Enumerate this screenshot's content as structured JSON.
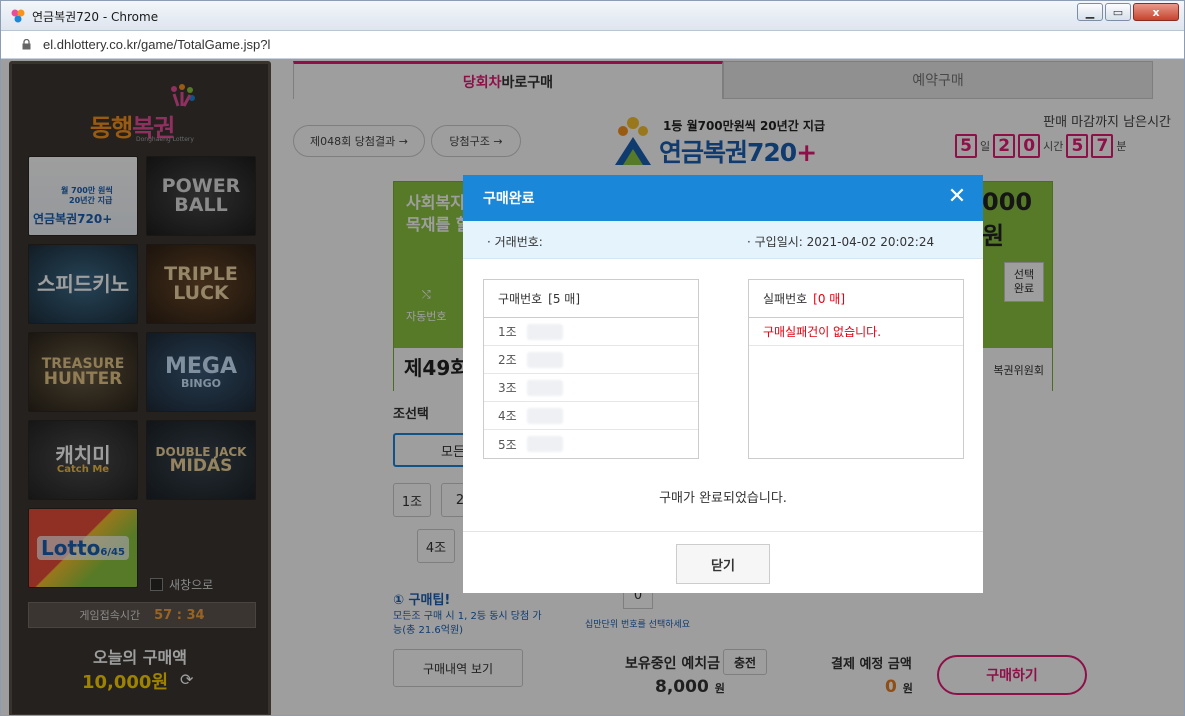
{
  "browser": {
    "title": "연금복권720 - Chrome",
    "url": "el.dhlottery.co.kr/game/TotalGame.jsp?l",
    "icons": {
      "app": "chrome-icon",
      "lock": "lock-icon",
      "minimize": "minimize-icon",
      "maximize": "maximize-icon",
      "close": "close-icon"
    },
    "close_glyph": "x"
  },
  "sidebar": {
    "logo": {
      "text_a": "동행",
      "text_b": "복권",
      "sub": "Donghaeng Lottery"
    },
    "games": [
      {
        "name": "연금복권720+",
        "line1": "월 700만 원씩",
        "line2": "20년간 지급"
      },
      {
        "name": "POWER BALL",
        "line1": "POWER",
        "line2": "BALL"
      },
      {
        "name": "스피드키노"
      },
      {
        "name": "TRIPLE LUCK",
        "line1": "TRIPLE",
        "line2": "LUCK"
      },
      {
        "name": "TREASURE HUNTER",
        "line1": "TREASURE",
        "line2": "HUNTER"
      },
      {
        "name": "MEGA BINGO",
        "line1": "MEGA",
        "line2": "BINGO"
      },
      {
        "name": "캐치미",
        "line2": "Catch Me"
      },
      {
        "name": "DOUBLE JACK MIDAS",
        "line1": "DOUBLE JACK",
        "line2": "MIDAS"
      },
      {
        "name": "Lotto 6/45",
        "line1": "Lotto",
        "line2": "6/45"
      }
    ],
    "new_window": "새창으로",
    "access_label": "게임접속시간",
    "access_time": "57 : 34",
    "today_label": "오늘의 구매액",
    "today_amount": "10,000원",
    "refresh_glyph": "⟳"
  },
  "main": {
    "tab_now_pink": "당회차",
    "tab_now_rest": " 바로구매",
    "tab_reserve": "예약구매",
    "pill_result": "제048회 당첨결과 →",
    "pill_structure": "당첨구조 →",
    "brand_top": "1등 월700만원씩 20년간 지급",
    "brand_name": "연금복권720",
    "brand_plus": "+",
    "deadline_label": "판매 마감까지 남은시간",
    "countdown": {
      "d": "5",
      "d_unit": "일",
      "h1": "2",
      "h2": "0",
      "h_unit": "시간",
      "m1": "5",
      "m2": "7",
      "m_unit": "분"
    },
    "ticket_text_1": "사회복지",
    "ticket_text_2": "목재를 할",
    "ticket_auto": "자동번호",
    "ticket_amount": "000원",
    "ticket_select": "선택\n완료",
    "ticket_round": "제49회",
    "ticket_org": "복권위원회",
    "group_select_label": "조선택",
    "group_all": "모든",
    "group_1": "1조",
    "group_2": "2",
    "group_4": "4조",
    "tip_title": "① 구매팁!",
    "tip_body": "모든조 구매 시 1, 2등 동시 당첨 가능(총 21.6억원)",
    "tip_right": "십만단위 번호를 선택하세요",
    "zero": "0",
    "history_btn": "구매내역 보기",
    "balance_label": "보유중인 예치금",
    "charge_btn": "충전",
    "balance_amount": "8,000",
    "won": "원",
    "pay_label": "결제 예정 금액",
    "pay_amount": "0",
    "buy_btn": "구매하기"
  },
  "modal": {
    "title": "구매완료",
    "tx_label": "· 거래번호:",
    "date_label": "· 구입일시: 2021-04-02 20:02:24",
    "bought": {
      "label": "구매번호",
      "count": "[5 매]"
    },
    "rows": [
      "1조",
      "2조",
      "3조",
      "4조",
      "5조"
    ],
    "failed": {
      "label": "실패번호",
      "count": "[0 매]",
      "message": "구매실패건이 없습니다."
    },
    "done_text": "구매가 완료되었습니다.",
    "close_btn": "닫기",
    "close_glyph": "✕"
  },
  "colors": {
    "pink": "#e61b76",
    "blue": "#1b87d8",
    "green": "#8cc63f",
    "sidebar": "#3a3632",
    "amber": "#ffd400"
  }
}
